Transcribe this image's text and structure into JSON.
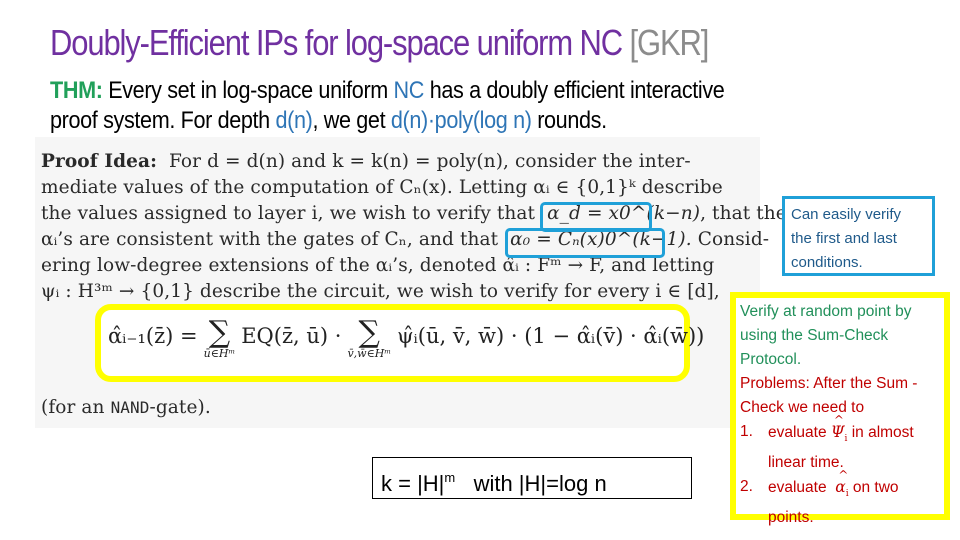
{
  "slide": {
    "title": "Doubly-Efficient IPs for log-space uniform NC",
    "title_ref": "[GKR]",
    "colors": {
      "title": "#7030a0",
      "ref": "#8c8c8c",
      "thm_label": "#21a05a",
      "highlight_blue": "#2e75b6",
      "frame_cyan": "#1fa0d8",
      "frame_yellow": "#ffff00",
      "note_green": "#21905a",
      "note_red": "#c00000"
    }
  },
  "theorem": {
    "label": "THM:",
    "line1_a": " Every set in log-space uniform ",
    "line1_nc": "NC",
    "line1_b": " has a doubly efficient interactive",
    "line2_a": "proof system. For depth ",
    "line2_dn": "d(n)",
    "line2_b": ", we get ",
    "line2_rounds": "d(n)·poly(log n)",
    "line2_c": " rounds."
  },
  "proof": {
    "heading": "Proof Idea:",
    "lines": [
      "For d = d(n) and k = k(n) = poly(n), consider the inter-",
      "mediate values of the computation of Cₙ(x).  Letting αᵢ ∈ {0,1}ᵏ describe",
      "the values assigned to layer i, we wish to verify that",
      "αᵢ’s are consistent with the gates of Cₙ, and that",
      "ering low-degree extensions of the αᵢ’s, denoted α̂ᵢ : Fᵐ → F, and letting",
      "ψᵢ : H³ᵐ → {0,1} describe the circuit, we wish to verify for every i ∈ [d],"
    ],
    "cond_last": "α_d = x0^(k−n)",
    "cond_first": "α₀ = Cₙ(x)0^(k−1).",
    "tail_line3": ", that the",
    "tail_line4": " Consid-",
    "footer_a": "(for an ",
    "footer_nand": "NAND",
    "footer_b": "-gate)."
  },
  "equation": {
    "lhs": "α̂ᵢ₋₁(z̄) =",
    "sum1_sub": "ū∈Hᵐ",
    "eq_term": "EQ(z̄, ū) ·",
    "sum2_sub": "v̄,w̄∈Hᵐ",
    "rhs": "ψ̂ᵢ(ū, v̄, w̄) · (1 − α̂ᵢ(v̄) · α̂ᵢ(w̄))"
  },
  "notes": {
    "blue_note": "Can easily verify the first and last conditions.",
    "k_box_a": "k = |H|",
    "k_box_sup": "m",
    "k_box_b": "   with |H|=log n",
    "yellow_green": "Verify at random point by using the Sum-Check Protocol.",
    "yellow_red_intro": "Problems: After the Sum -Check we need to",
    "items": [
      {
        "num": "1.",
        "a": "evaluate ",
        "sym": "Ψ",
        "b": " in almost linear time."
      },
      {
        "num": "2.",
        "a": "evaluate  ",
        "sym": "α",
        "b": " on two points."
      }
    ],
    "sym_sub": "i",
    "hat": "^"
  }
}
